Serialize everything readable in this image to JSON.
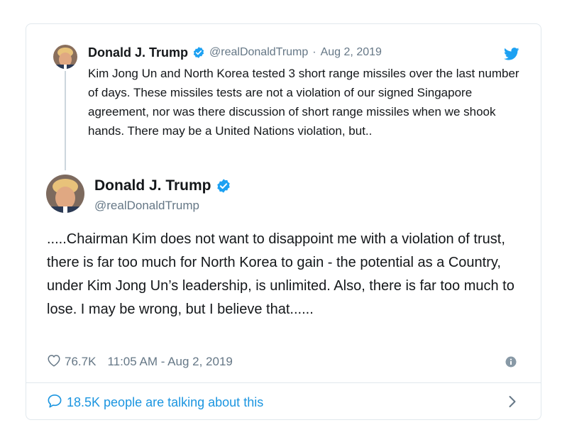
{
  "parent_tweet": {
    "author_name": "Donald J. Trump",
    "handle": "@realDonaldTrump",
    "separator": "·",
    "date": "Aug 2, 2019",
    "text": "Kim Jong Un and North Korea tested 3 short range missiles over the last number of days. These missiles tests are not a violation of our signed Singapore agreement, nor was there discussion of short range missiles when we shook hands. There may be a United Nations violation, but.."
  },
  "main_tweet": {
    "author_name": "Donald J. Trump",
    "handle": "@realDonaldTrump",
    "text": ".....Chairman Kim does not want to disappoint me with a violation of trust, there is far too much for North Korea to gain - the potential as a Country, under Kim Jong Un’s leadership, is unlimited. Also, there is far too much to lose. I may be wrong, but I believe that......",
    "likes": "76.7K",
    "timestamp": "11:05 AM - Aug 2, 2019"
  },
  "footer": {
    "talking_text": "18.5K people are talking about this"
  },
  "colors": {
    "accent": "#1da1f2",
    "link": "#1b95e0",
    "muted": "#657786",
    "border": "#e1e8ed",
    "text": "#14171a"
  },
  "icons": {
    "verified": "verified-badge-icon",
    "brand": "twitter-bird-icon",
    "like": "heart-outline-icon",
    "info": "info-icon",
    "reply": "speech-bubble-icon",
    "chevron": "chevron-right-icon"
  }
}
